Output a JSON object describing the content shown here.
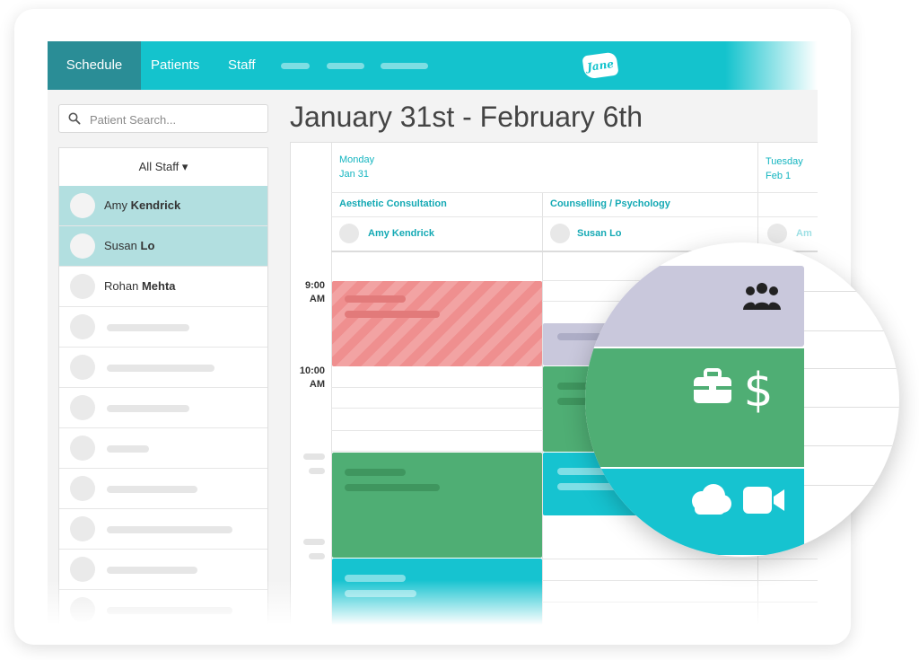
{
  "nav": {
    "schedule": "Schedule",
    "patients": "Patients",
    "staff": "Staff"
  },
  "logo": {
    "text": "Jane"
  },
  "search": {
    "placeholder": "Patient Search..."
  },
  "staff_filter": {
    "label": "All Staff ▾"
  },
  "staff": [
    {
      "first": "Amy",
      "last": "Kendrick",
      "selected": true
    },
    {
      "first": "Susan",
      "last": "Lo",
      "selected": true
    },
    {
      "first": "Rohan",
      "last": "Mehta",
      "selected": false
    }
  ],
  "calendar": {
    "title": "January 31st - February 6th",
    "days": [
      {
        "name": "Monday",
        "date": "Jan 31"
      },
      {
        "name": "Tuesday",
        "date": "Feb 1"
      }
    ],
    "columns": [
      {
        "discipline": "Aesthetic Consultation",
        "practitioner": "Amy Kendrick"
      },
      {
        "discipline": "Counselling / Psychology",
        "practitioner": "Susan Lo"
      },
      {
        "practitioner_partial": "Am"
      }
    ],
    "times": [
      {
        "hour": "9:00",
        "period": "AM"
      },
      {
        "hour": "10:00",
        "period": "AM"
      }
    ]
  },
  "colors": {
    "brand": "#14c3cd",
    "nav_active": "#2a8d96",
    "selected_row": "#b2dfe0",
    "appt_red": "#ef8f8f",
    "appt_green": "#4fae74",
    "appt_lavender": "#c9c8dc",
    "appt_teal": "#16c3d0"
  },
  "magnifier_icons": [
    "group-icon",
    "briefcase-icon",
    "dollar-icon",
    "cloud-icon",
    "video-camera-icon"
  ]
}
